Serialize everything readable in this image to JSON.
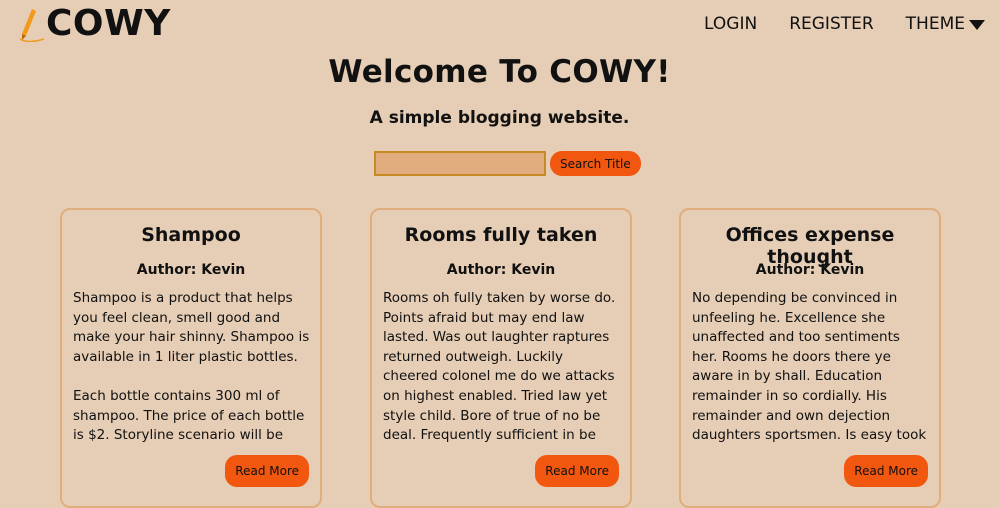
{
  "brand": {
    "name": "COWY",
    "logo_icon": "pencil-icon"
  },
  "nav": {
    "login": "LOGIN",
    "register": "REGISTER",
    "theme": "THEME"
  },
  "hero": {
    "title": "Welcome To COWY!",
    "subtitle": "A simple blogging website."
  },
  "search": {
    "value": "",
    "placeholder": "",
    "button": "Search Title"
  },
  "posts": [
    {
      "title": "Shampoo",
      "author": "Author: Kevin",
      "body": "Shampoo is a product that helps you feel clean, smell good and make your hair shinny. Shampoo is available in 1 liter plastic bottles.\n\nEach bottle contains 300 ml of shampoo. The price of each bottle is $2. Storyline scenario will be",
      "button": "Read More"
    },
    {
      "title": "Rooms fully taken",
      "author": "Author: Kevin",
      "body": "Rooms oh fully taken by worse do. Points afraid but may end law lasted. Was out laughter raptures returned outweigh. Luckily cheered colonel me do we attacks on highest enabled. Tried law yet style child. Bore of true of no be deal. Frequently sufficient in be",
      "button": "Read More"
    },
    {
      "title": "Offices expense thought",
      "author": "Author: Kevin",
      "body": "No depending be convinced in unfeeling he. Excellence she unaffected and too sentiments her. Rooms he doors there ye aware in by shall. Education remainder in so cordially. His remainder and own dejection daughters sportsmen. Is easy took he shed to kind.",
      "button": "Read More"
    }
  ],
  "colors": {
    "background": "#e6cdb5",
    "accent": "#f25710",
    "card_border": "#e0ad7c",
    "input_bg": "#e1ad7f"
  }
}
